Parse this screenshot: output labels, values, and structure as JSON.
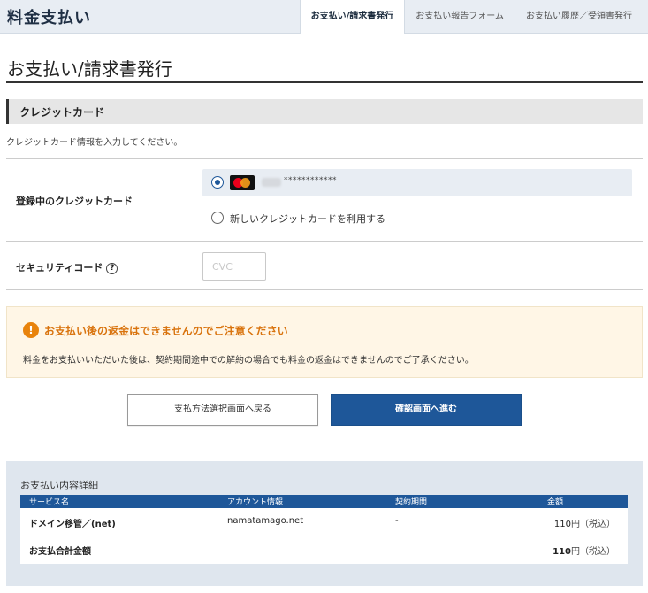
{
  "header": {
    "app_title": "料金支払い",
    "tabs": [
      {
        "label": "お支払い/請求書発行",
        "active": true
      },
      {
        "label": "お支払い報告フォーム",
        "active": false
      },
      {
        "label": "お支払い履歴／受領書発行",
        "active": false
      }
    ]
  },
  "page_title": "お支払い/請求書発行",
  "credit_section": {
    "heading": "クレジットカード",
    "description": "クレジットカード情報を入力してください。",
    "registered_label": "登録中のクレジットカード",
    "registered_card_number": "************",
    "new_card_label": "新しいクレジットカードを利用する",
    "security_label": "セキュリティコード",
    "security_help_icon": "?",
    "security_placeholder": "CVC"
  },
  "warning": {
    "icon": "!",
    "title": "お支払い後の返金はできませんのでご注意ください",
    "text": "料金をお支払いいただいた後は、契約期間途中での解約の場合でも料金の返金はできませんのでご了承ください。"
  },
  "buttons": {
    "back": "支払方法選択画面へ戻る",
    "next": "確認画面へ進む"
  },
  "details": {
    "title": "お支払い内容詳細",
    "columns": [
      "サービス名",
      "アカウント情報",
      "契約期間",
      "金額"
    ],
    "rows": [
      {
        "service": "ドメイン移管／(net)",
        "account": "namatamago.net",
        "period": "-",
        "amount": "110",
        "unit_tax": "円（税込）"
      }
    ],
    "total_label": "お支払合計金額",
    "total_amount": "110",
    "total_unit_tax": "円（税込）"
  },
  "colors": {
    "primary": "#1e5799",
    "warning": "#e8830c",
    "header_bg": "#e8edf3"
  }
}
